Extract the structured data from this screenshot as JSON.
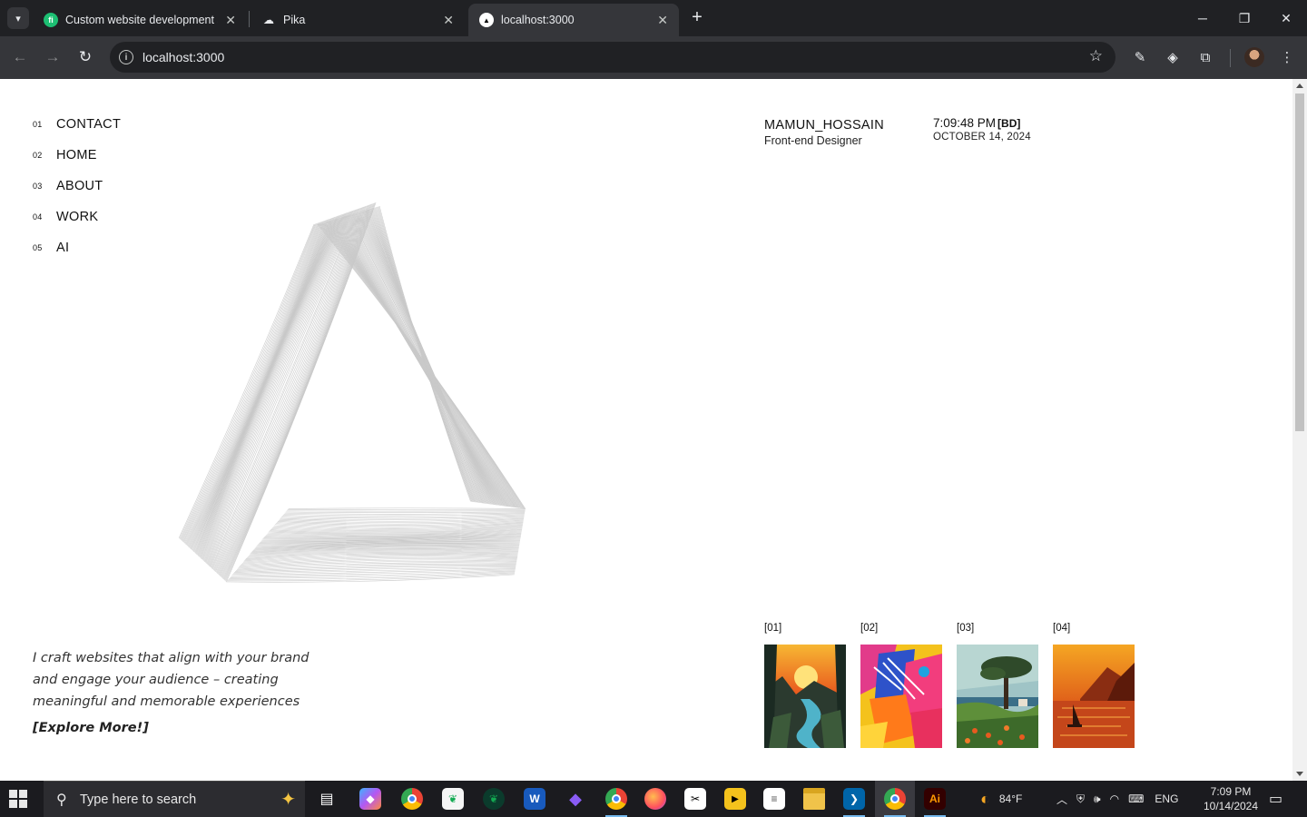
{
  "browser": {
    "tabs": [
      {
        "title": "Custom website development s",
        "favicon": "fiverr-icon",
        "active": false
      },
      {
        "title": "Pika",
        "favicon": "pika-cloud-icon",
        "active": false
      },
      {
        "title": "localhost:3000",
        "favicon": "nextjs-icon",
        "active": true
      }
    ],
    "url": "localhost:3000"
  },
  "page": {
    "menu": [
      {
        "num": "01",
        "label": "CONTACT"
      },
      {
        "num": "02",
        "label": "HOME"
      },
      {
        "num": "03",
        "label": "ABOUT"
      },
      {
        "num": "04",
        "label": "WORK"
      },
      {
        "num": "05",
        "label": "AI"
      }
    ],
    "profile": {
      "name": "MAMUN_HOSSAIN",
      "role": "Front-end Designer"
    },
    "clock": {
      "time": "7:09:48 PM",
      "tz": "[BD]",
      "date": "OCTOBER 14, 2024"
    },
    "tagline": "I craft websites that align with your brand and engage your audience – creating meaningful and memorable experiences",
    "cta": "[Explore More!]",
    "gallery": [
      {
        "label": "[01]"
      },
      {
        "label": "[02]"
      },
      {
        "label": "[03]"
      },
      {
        "label": "[04]"
      }
    ]
  },
  "taskbar": {
    "search_placeholder": "Type here to search",
    "weather": "84°F",
    "language": "ENG",
    "time": "7:09 PM",
    "date": "10/14/2024"
  }
}
